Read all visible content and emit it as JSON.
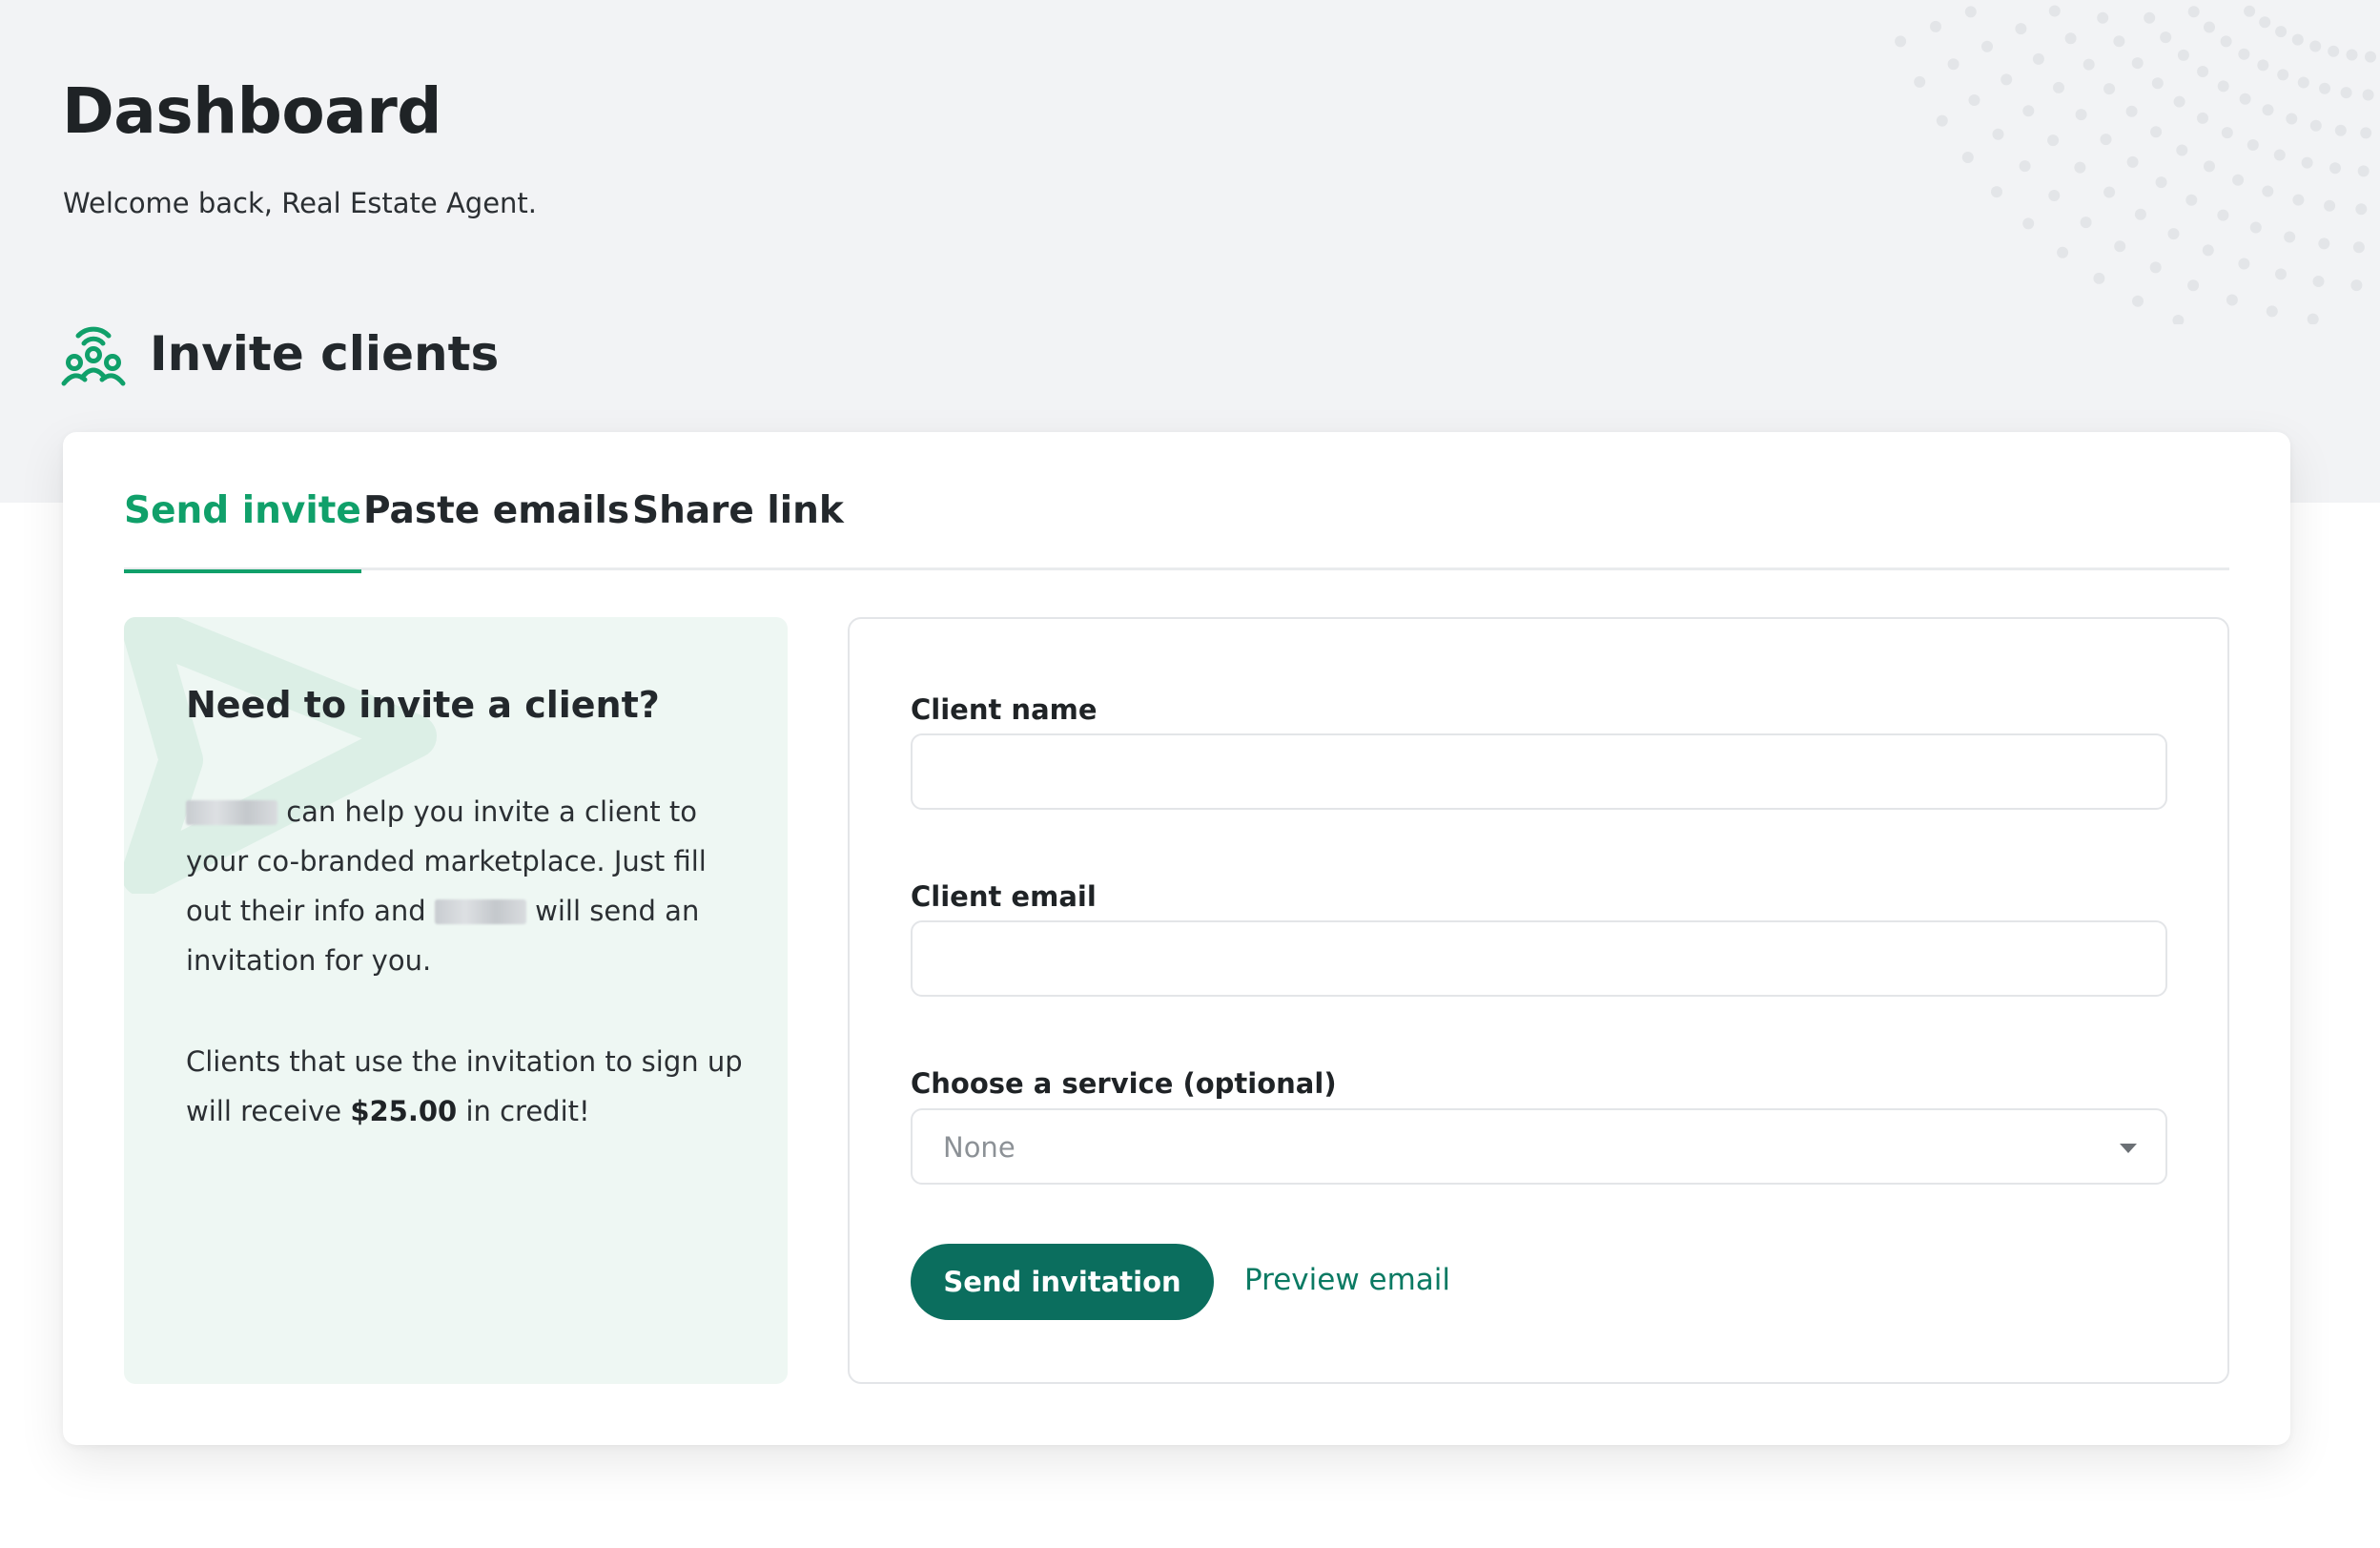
{
  "header": {
    "title": "Dashboard",
    "welcome": "Welcome back, Real Estate Agent."
  },
  "section": {
    "title": "Invite clients",
    "icon": "people-broadcast-icon"
  },
  "tabs": [
    {
      "label": "Send invite",
      "active": true
    },
    {
      "label": "Paste emails",
      "active": false
    },
    {
      "label": "Share link",
      "active": false
    }
  ],
  "info": {
    "heading": "Need to invite a client?",
    "body_part1": "can help you invite a client to your co-branded marketplace. Just fill out their info and",
    "body_part2": "will send an invitation for you.",
    "credit_prefix": "Clients that use the invitation to sign up will receive",
    "credit_amount": "$25.00",
    "credit_suffix": "in credit!"
  },
  "form": {
    "name_label": "Client name",
    "name_value": "",
    "email_label": "Client email",
    "email_value": "",
    "service_label": "Choose a service (optional)",
    "service_value": "None",
    "send_label": "Send invitation",
    "preview_label": "Preview email"
  },
  "colors": {
    "accent": "#10a06a",
    "button": "#0b6e5e",
    "link": "#0b7a63",
    "band": "#f2f3f5",
    "info_bg": "#eef7f3"
  }
}
